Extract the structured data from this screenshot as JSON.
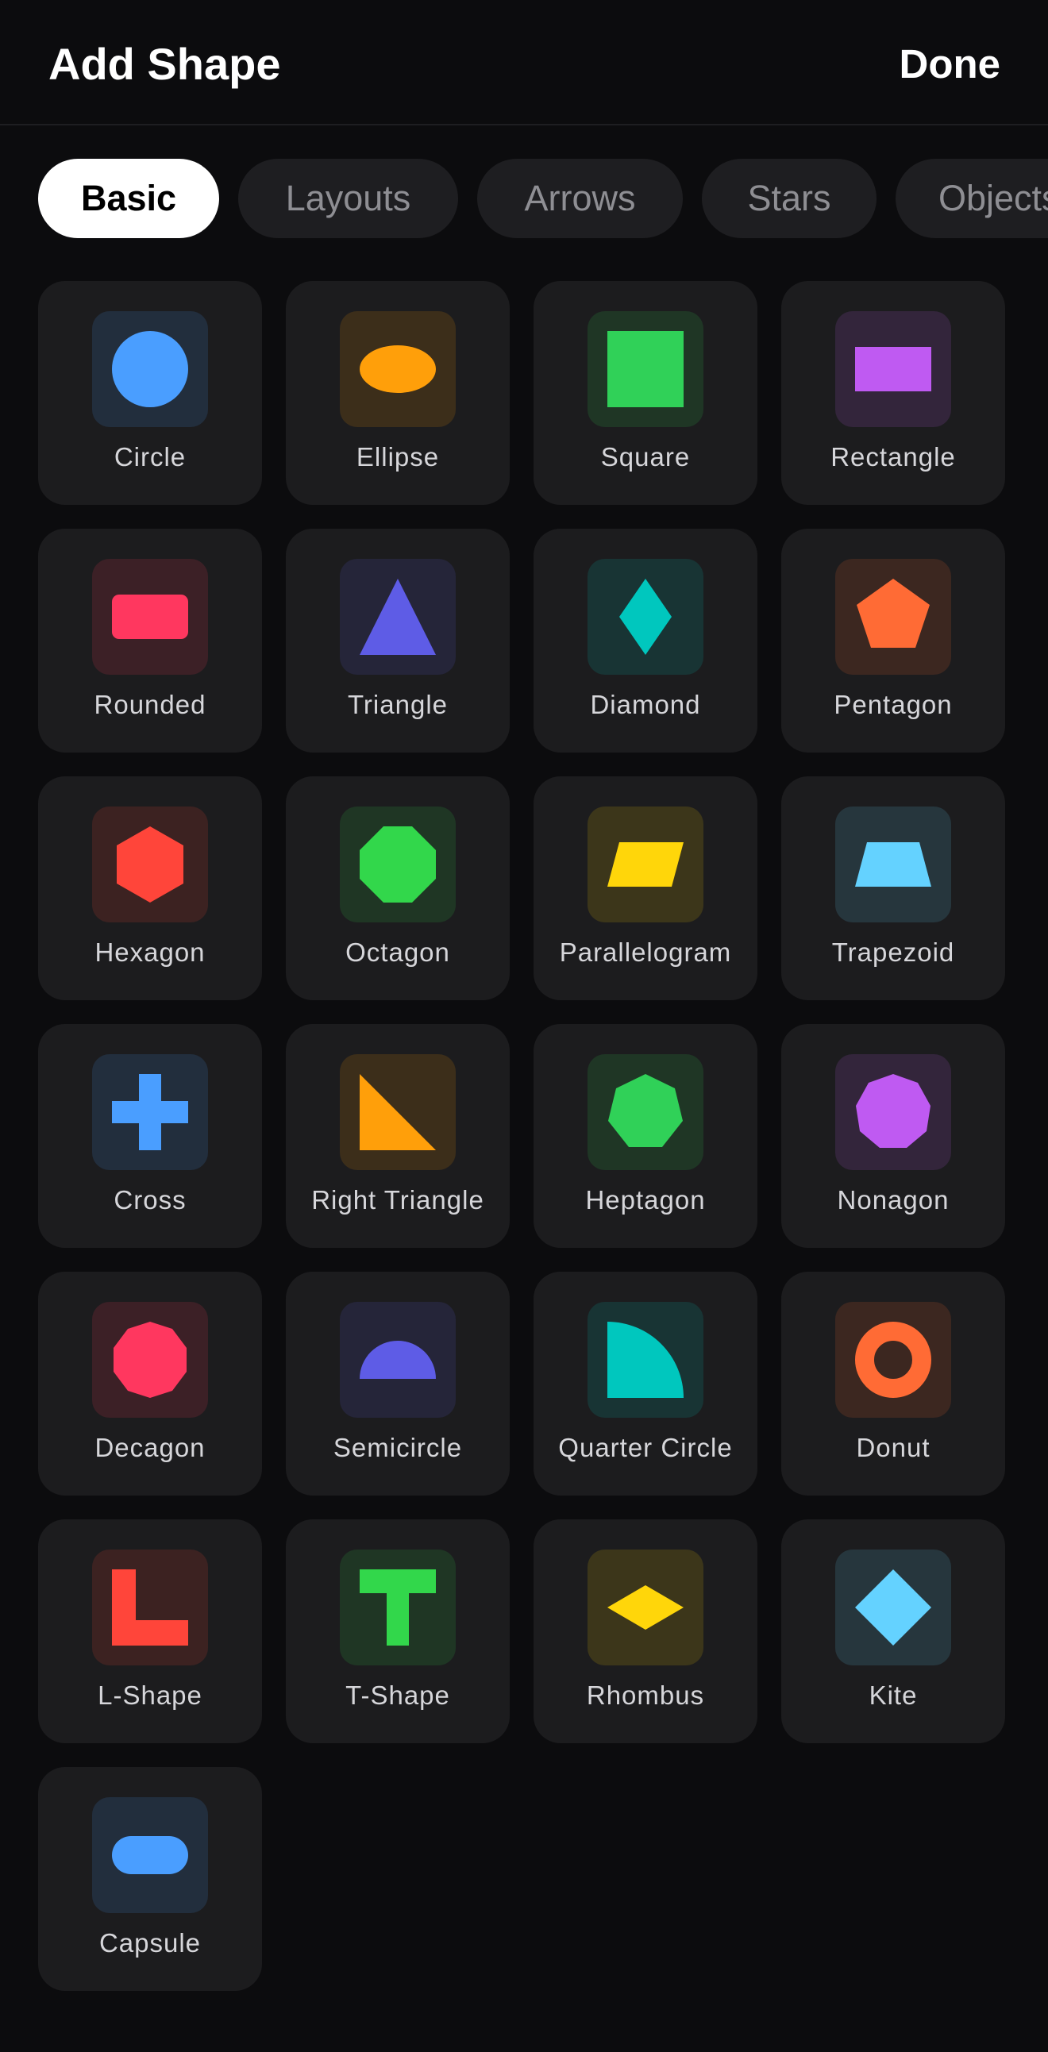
{
  "header": {
    "title": "Add Shape",
    "done_label": "Done"
  },
  "tabs": [
    {
      "label": "Basic",
      "active": true
    },
    {
      "label": "Layouts",
      "active": false
    },
    {
      "label": "Arrows",
      "active": false
    },
    {
      "label": "Stars",
      "active": false
    },
    {
      "label": "Objects",
      "active": false
    }
  ],
  "shapes": [
    {
      "label": "Circle",
      "icon": "circle-icon",
      "color": "#4a9eff"
    },
    {
      "label": "Ellipse",
      "icon": "ellipse-icon",
      "color": "#ff9f0a"
    },
    {
      "label": "Square",
      "icon": "square-icon",
      "color": "#30d158"
    },
    {
      "label": "Rectangle",
      "icon": "rectangle-icon",
      "color": "#bf5af2"
    },
    {
      "label": "Rounded",
      "icon": "rounded-rectangle-icon",
      "color": "#ff375f"
    },
    {
      "label": "Triangle",
      "icon": "triangle-icon",
      "color": "#5e5ce6"
    },
    {
      "label": "Diamond",
      "icon": "diamond-icon",
      "color": "#00c7be"
    },
    {
      "label": "Pentagon",
      "icon": "pentagon-icon",
      "color": "#ff6b35"
    },
    {
      "label": "Hexagon",
      "icon": "hexagon-icon",
      "color": "#ff453a"
    },
    {
      "label": "Octagon",
      "icon": "octagon-icon",
      "color": "#32d74b"
    },
    {
      "label": "Parallelogram",
      "icon": "parallelogram-icon",
      "color": "#ffd60a"
    },
    {
      "label": "Trapezoid",
      "icon": "trapezoid-icon",
      "color": "#64d2ff"
    },
    {
      "label": "Cross",
      "icon": "cross-icon",
      "color": "#4a9eff"
    },
    {
      "label": "Right Triangle",
      "icon": "right-triangle-icon",
      "color": "#ff9f0a"
    },
    {
      "label": "Heptagon",
      "icon": "heptagon-icon",
      "color": "#30d158"
    },
    {
      "label": "Nonagon",
      "icon": "nonagon-icon",
      "color": "#bf5af2"
    },
    {
      "label": "Decagon",
      "icon": "decagon-icon",
      "color": "#ff375f"
    },
    {
      "label": "Semicircle",
      "icon": "semicircle-icon",
      "color": "#5e5ce6"
    },
    {
      "label": "Quarter Circle",
      "icon": "quarter-circle-icon",
      "color": "#00c7be"
    },
    {
      "label": "Donut",
      "icon": "donut-icon",
      "color": "#ff6b35"
    },
    {
      "label": "L-Shape",
      "icon": "l-shape-icon",
      "color": "#ff453a"
    },
    {
      "label": "T-Shape",
      "icon": "t-shape-icon",
      "color": "#32d74b"
    },
    {
      "label": "Rhombus",
      "icon": "rhombus-icon",
      "color": "#ffd60a"
    },
    {
      "label": "Kite",
      "icon": "kite-icon",
      "color": "#64d2ff"
    },
    {
      "label": "Capsule",
      "icon": "capsule-icon",
      "color": "#4a9eff"
    }
  ]
}
